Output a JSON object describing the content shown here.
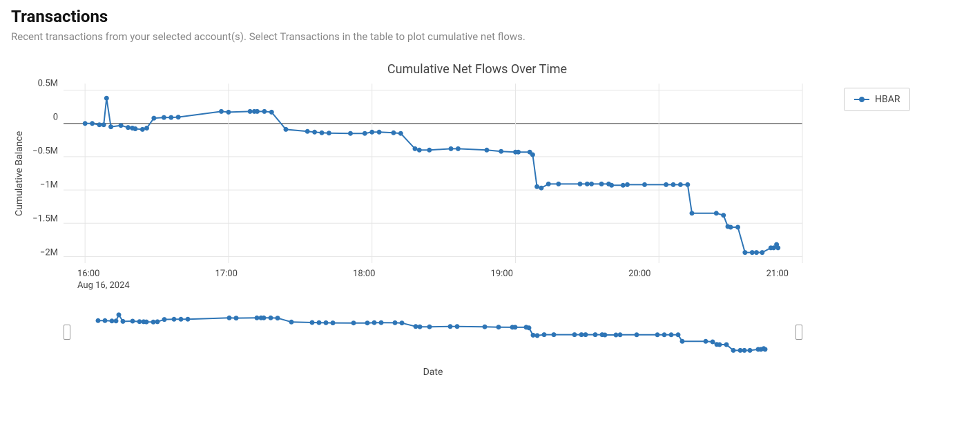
{
  "page": {
    "title": "Transactions",
    "subtitle": "Recent transactions from your selected account(s). Select Transactions in the table to plot cumulative net flows."
  },
  "chart_data": {
    "type": "line",
    "title": "Cumulative Net Flows Over Time",
    "xlabel": "Date",
    "ylabel": "Cumulative Balance",
    "x_date": "Aug 16, 2024",
    "x_ticks": [
      "16:00",
      "17:00",
      "18:00",
      "19:00",
      "20:00",
      "21:00"
    ],
    "y_ticks": [
      "0.5M",
      "0",
      "−0.5M",
      "−1M",
      "−1.5M",
      "−2M"
    ],
    "ylim": [
      -2100000,
      600000
    ],
    "xlim_hours": [
      15.85,
      21.0
    ],
    "legend": [
      "HBAR"
    ],
    "series": [
      {
        "name": "HBAR",
        "points": [
          {
            "t": 16.0,
            "v": 0
          },
          {
            "t": 16.05,
            "v": 0
          },
          {
            "t": 16.1,
            "v": -20000
          },
          {
            "t": 16.13,
            "v": -20000
          },
          {
            "t": 16.15,
            "v": 380000
          },
          {
            "t": 16.18,
            "v": -50000
          },
          {
            "t": 16.25,
            "v": -30000
          },
          {
            "t": 16.3,
            "v": -60000
          },
          {
            "t": 16.33,
            "v": -70000
          },
          {
            "t": 16.35,
            "v": -80000
          },
          {
            "t": 16.4,
            "v": -90000
          },
          {
            "t": 16.43,
            "v": -70000
          },
          {
            "t": 16.48,
            "v": 80000
          },
          {
            "t": 16.55,
            "v": 90000
          },
          {
            "t": 16.6,
            "v": 90000
          },
          {
            "t": 16.65,
            "v": 95000
          },
          {
            "t": 16.95,
            "v": 180000
          },
          {
            "t": 17.0,
            "v": 170000
          },
          {
            "t": 17.15,
            "v": 180000
          },
          {
            "t": 17.18,
            "v": 180000
          },
          {
            "t": 17.2,
            "v": 180000
          },
          {
            "t": 17.25,
            "v": 180000
          },
          {
            "t": 17.3,
            "v": 170000
          },
          {
            "t": 17.4,
            "v": -90000
          },
          {
            "t": 17.55,
            "v": -120000
          },
          {
            "t": 17.6,
            "v": -130000
          },
          {
            "t": 17.65,
            "v": -140000
          },
          {
            "t": 17.7,
            "v": -145000
          },
          {
            "t": 17.85,
            "v": -150000
          },
          {
            "t": 17.95,
            "v": -150000
          },
          {
            "t": 18.0,
            "v": -130000
          },
          {
            "t": 18.05,
            "v": -130000
          },
          {
            "t": 18.15,
            "v": -140000
          },
          {
            "t": 18.2,
            "v": -150000
          },
          {
            "t": 18.3,
            "v": -380000
          },
          {
            "t": 18.33,
            "v": -400000
          },
          {
            "t": 18.4,
            "v": -400000
          },
          {
            "t": 18.55,
            "v": -380000
          },
          {
            "t": 18.6,
            "v": -380000
          },
          {
            "t": 18.8,
            "v": -400000
          },
          {
            "t": 18.9,
            "v": -420000
          },
          {
            "t": 19.0,
            "v": -430000
          },
          {
            "t": 19.02,
            "v": -430000
          },
          {
            "t": 19.1,
            "v": -430000
          },
          {
            "t": 19.12,
            "v": -470000
          },
          {
            "t": 19.15,
            "v": -950000
          },
          {
            "t": 19.18,
            "v": -970000
          },
          {
            "t": 19.23,
            "v": -910000
          },
          {
            "t": 19.3,
            "v": -910000
          },
          {
            "t": 19.45,
            "v": -910000
          },
          {
            "t": 19.5,
            "v": -910000
          },
          {
            "t": 19.53,
            "v": -910000
          },
          {
            "t": 19.6,
            "v": -910000
          },
          {
            "t": 19.65,
            "v": -910000
          },
          {
            "t": 19.67,
            "v": -930000
          },
          {
            "t": 19.75,
            "v": -930000
          },
          {
            "t": 19.78,
            "v": -920000
          },
          {
            "t": 19.9,
            "v": -920000
          },
          {
            "t": 20.05,
            "v": -920000
          },
          {
            "t": 20.1,
            "v": -920000
          },
          {
            "t": 20.15,
            "v": -920000
          },
          {
            "t": 20.2,
            "v": -920000
          },
          {
            "t": 20.23,
            "v": -1350000
          },
          {
            "t": 20.4,
            "v": -1350000
          },
          {
            "t": 20.45,
            "v": -1380000
          },
          {
            "t": 20.48,
            "v": -1550000
          },
          {
            "t": 20.5,
            "v": -1560000
          },
          {
            "t": 20.55,
            "v": -1560000
          },
          {
            "t": 20.6,
            "v": -1940000
          },
          {
            "t": 20.65,
            "v": -1940000
          },
          {
            "t": 20.68,
            "v": -1940000
          },
          {
            "t": 20.72,
            "v": -1940000
          },
          {
            "t": 20.78,
            "v": -1870000
          },
          {
            "t": 20.8,
            "v": -1870000
          },
          {
            "t": 20.82,
            "v": -1820000
          },
          {
            "t": 20.83,
            "v": -1870000
          }
        ]
      }
    ]
  }
}
